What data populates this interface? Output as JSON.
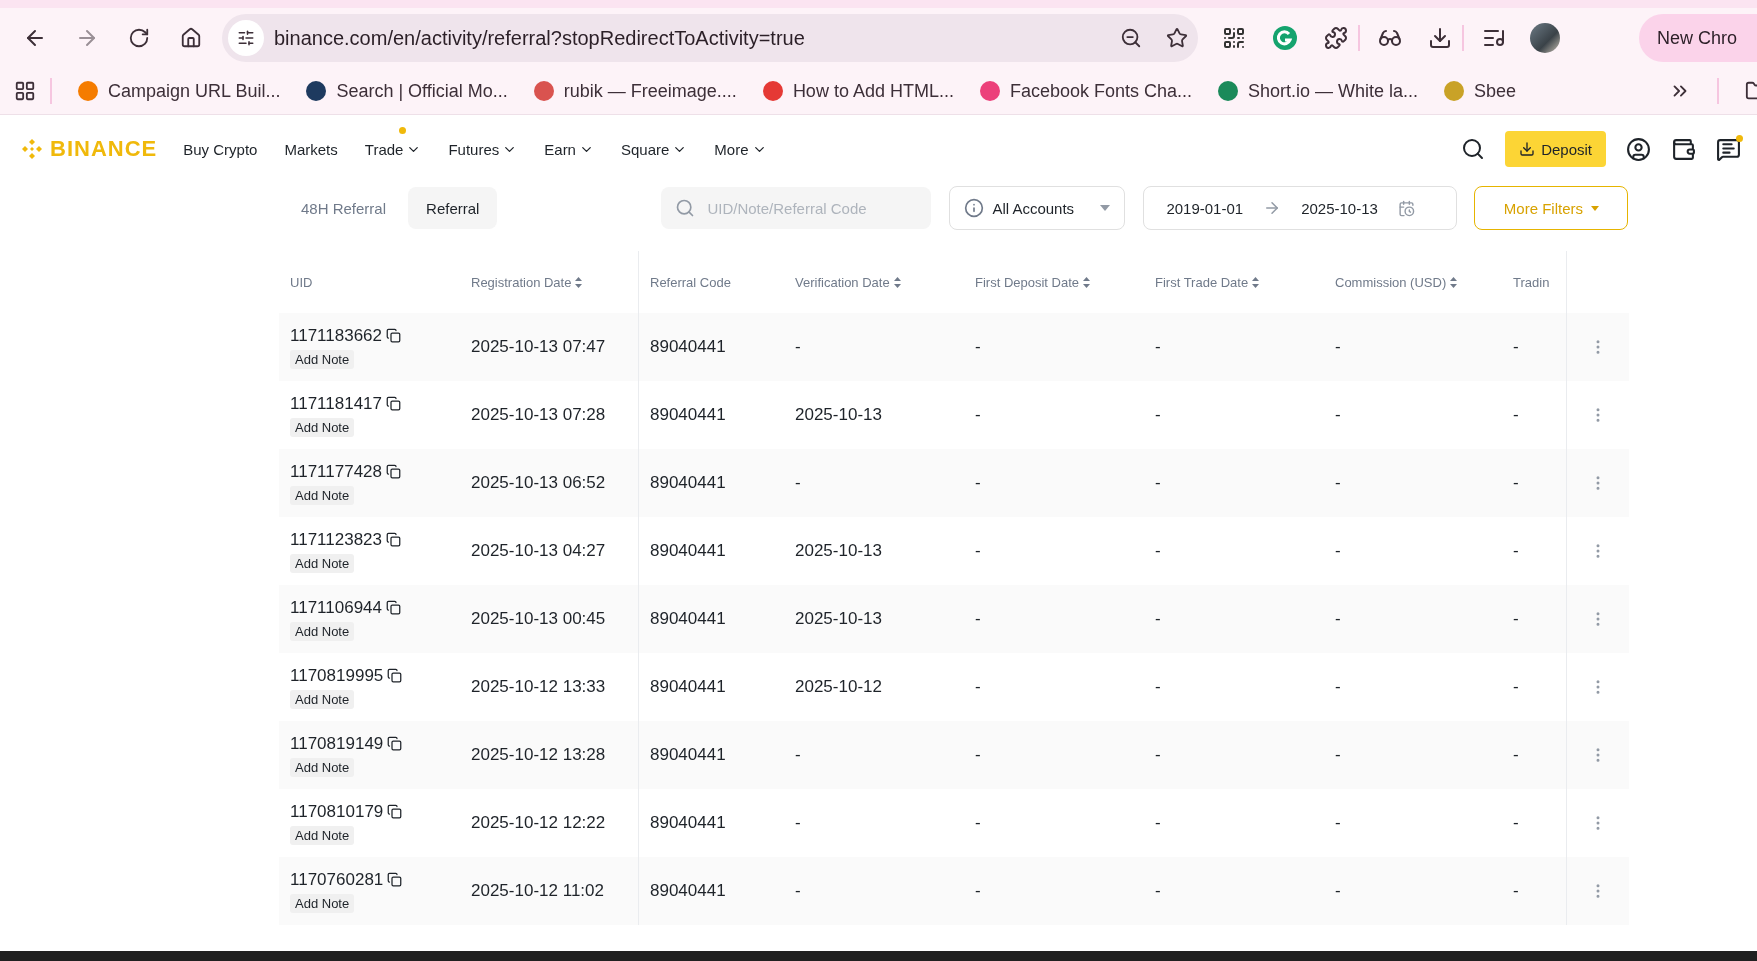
{
  "browser": {
    "url": "binance.com/en/activity/referral?stopRedirectToActivity=true",
    "profile_button": "New Chro",
    "bookmarks": [
      {
        "label": "Campaign URL Buil...",
        "color": "#f57c00"
      },
      {
        "label": "Search | Official Mo...",
        "color": "#1e3a5f"
      },
      {
        "label": "rubik — Freeimage....",
        "color": "#d9534f"
      },
      {
        "label": "How to Add HTML...",
        "color": "#e53935"
      },
      {
        "label": "Facebook Fonts Cha...",
        "color": "#ec407a"
      },
      {
        "label": "Short.io — White la...",
        "color": "#1b8a5a"
      },
      {
        "label": "Sbee",
        "color": "#c9a227"
      }
    ]
  },
  "header": {
    "logo": "BINANCE",
    "nav": [
      {
        "label": "Buy Crypto",
        "dropdown": false,
        "dot": false
      },
      {
        "label": "Markets",
        "dropdown": false,
        "dot": false
      },
      {
        "label": "Trade",
        "dropdown": true,
        "dot": true
      },
      {
        "label": "Futures",
        "dropdown": true,
        "dot": false
      },
      {
        "label": "Earn",
        "dropdown": true,
        "dot": false
      },
      {
        "label": "Square",
        "dropdown": true,
        "dot": false
      },
      {
        "label": "More",
        "dropdown": true,
        "dot": false
      }
    ],
    "deposit": "Deposit",
    "messages_dot": true
  },
  "filters": {
    "tabs": [
      {
        "label": "48H Referral",
        "selected": false
      },
      {
        "label": "Referral",
        "selected": true
      }
    ],
    "search": {
      "placeholder": "UID/Note/Referral Code"
    },
    "account": "All Accounts",
    "date_from": "2019-01-01",
    "date_to": "2025-10-13",
    "more": "More Filters"
  },
  "table": {
    "columns": [
      {
        "label": "UID",
        "sortable": false
      },
      {
        "label": "Registration Date",
        "sortable": true
      },
      {
        "label": "Referral Code",
        "sortable": false
      },
      {
        "label": "Verification Date",
        "sortable": true
      },
      {
        "label": "First Deposit Date",
        "sortable": true
      },
      {
        "label": "First Trade Date",
        "sortable": true
      },
      {
        "label": "Commission (USD)",
        "sortable": true
      },
      {
        "label": "Tradin",
        "sortable": false
      }
    ],
    "rows": [
      {
        "note": "Add Note",
        "uid": "1171183662",
        "registration": "2025-10-13 07:47",
        "code": "89040441",
        "verification": "-",
        "deposit": "-",
        "trade": "-",
        "commission": "-",
        "trading": "-"
      },
      {
        "note": "Add Note",
        "uid": "1171181417",
        "registration": "2025-10-13 07:28",
        "code": "89040441",
        "verification": "2025-10-13",
        "deposit": "-",
        "trade": "-",
        "commission": "-",
        "trading": "-"
      },
      {
        "note": "Add Note",
        "uid": "1171177428",
        "registration": "2025-10-13 06:52",
        "code": "89040441",
        "verification": "-",
        "deposit": "-",
        "trade": "-",
        "commission": "-",
        "trading": "-"
      },
      {
        "note": "Add Note",
        "uid": "1171123823",
        "registration": "2025-10-13 04:27",
        "code": "89040441",
        "verification": "2025-10-13",
        "deposit": "-",
        "trade": "-",
        "commission": "-",
        "trading": "-"
      },
      {
        "note": "Add Note",
        "uid": "1171106944",
        "registration": "2025-10-13 00:45",
        "code": "89040441",
        "verification": "2025-10-13",
        "deposit": "-",
        "trade": "-",
        "commission": "-",
        "trading": "-"
      },
      {
        "note": "Add Note",
        "uid": "1170819995",
        "registration": "2025-10-12 13:33",
        "code": "89040441",
        "verification": "2025-10-12",
        "deposit": "-",
        "trade": "-",
        "commission": "-",
        "trading": "-"
      },
      {
        "note": "Add Note",
        "uid": "1170819149",
        "registration": "2025-10-12 13:28",
        "code": "89040441",
        "verification": "-",
        "deposit": "-",
        "trade": "-",
        "commission": "-",
        "trading": "-"
      },
      {
        "note": "Add Note",
        "uid": "1170810179",
        "registration": "2025-10-12 12:22",
        "code": "89040441",
        "verification": "-",
        "deposit": "-",
        "trade": "-",
        "commission": "-",
        "trading": "-"
      },
      {
        "note": "Add Note",
        "uid": "1170760281",
        "registration": "2025-10-12 11:02",
        "code": "89040441",
        "verification": "-",
        "deposit": "-",
        "trade": "-",
        "commission": "-",
        "trading": "-"
      }
    ]
  }
}
